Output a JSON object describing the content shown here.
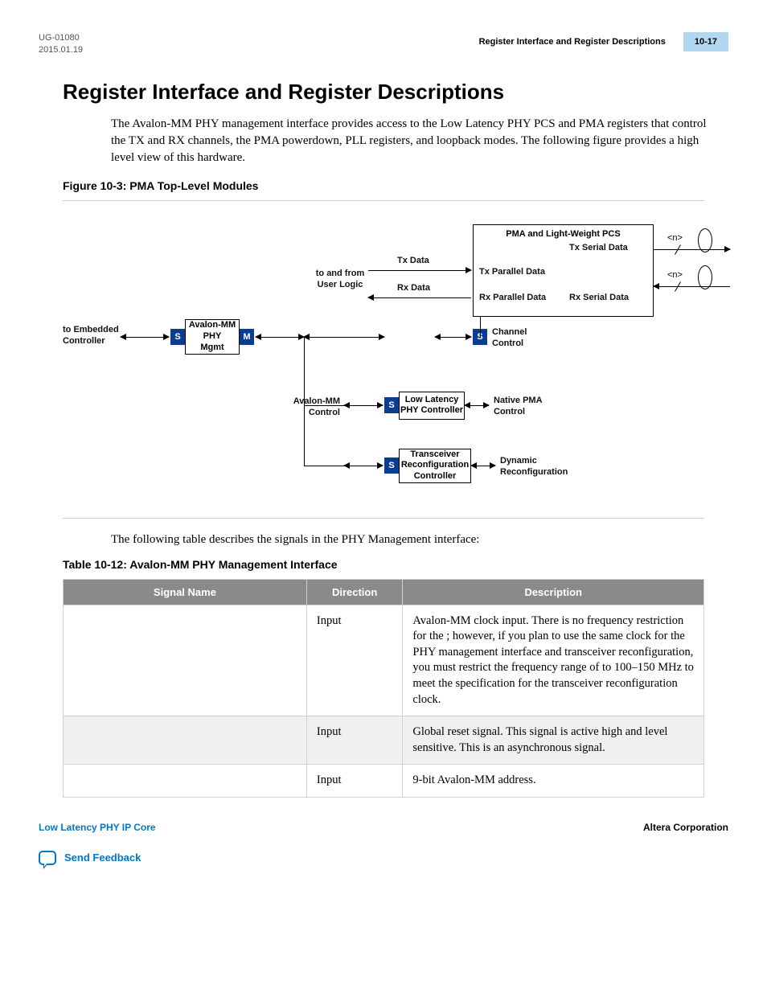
{
  "header": {
    "doc_id": "UG-01080",
    "date": "2015.01.19",
    "section_title": "Register Interface and Register Descriptions",
    "page_num": "10-17"
  },
  "title": "Register Interface and Register Descriptions",
  "intro": "The Avalon-MM PHY management interface provides access to the Low Latency PHY PCS and PMA registers that control the TX and RX channels, the PMA powerdown, PLL registers, and loopback modes. The following figure provides a high level view of this hardware.",
  "figure_caption": "Figure 10-3: PMA Top-Level Modules",
  "diagram": {
    "to_embedded": "to Embedded\nController",
    "avalon_phy_mgmt": "Avalon-MM\nPHY\nMgmt",
    "to_from_user": "to and from\nUser Logic",
    "tx_data": "Tx Data",
    "rx_data": "Rx Data",
    "pma_pcs_box": "PMA and Light-Weight PCS",
    "tx_parallel": "Tx Parallel Data",
    "rx_parallel": "Rx Parallel Data",
    "tx_serial": "Tx Serial Data",
    "rx_serial": "Rx Serial Data",
    "n_tag": "<n>",
    "channel_control": "Channel\nControl",
    "avalon_control": "Avalon-MM\nControl",
    "low_latency": "Low Latency\nPHY Controller",
    "native_pma": "Native PMA\nControl",
    "xcvr_reconfig": "Transceiver\nReconfiguration\nController",
    "dynamic_reconfig": "Dynamic\nReconfiguration",
    "tag_s": "S",
    "tag_m": "M"
  },
  "after_figure": "The following table describes the signals in the PHY Management interface:",
  "table_caption": "Table 10-12: Avalon-MM PHY Management Interface",
  "table": {
    "headers": [
      "Signal Name",
      "Direction",
      "Description"
    ],
    "rows": [
      {
        "signal": "",
        "direction": "Input",
        "description": "Avalon-MM clock input. There is no frequency restriction for the                           ; however, if you plan to use the same clock for the PHY management interface and transceiver reconfiguration, you must restrict the frequency range of                 to 100–150 MHz to meet the specifica­tion for the transceiver reconfiguration clock."
      },
      {
        "signal": "",
        "direction": "Input",
        "description": "Global reset signal. This signal is active high and level sensitive. This is an asynchronous signal."
      },
      {
        "signal": "",
        "direction": "Input",
        "description": "9-bit Avalon-MM address."
      }
    ]
  },
  "footer": {
    "left": "Low Latency PHY IP Core",
    "right": "Altera Corporation",
    "feedback": "Send Feedback"
  }
}
